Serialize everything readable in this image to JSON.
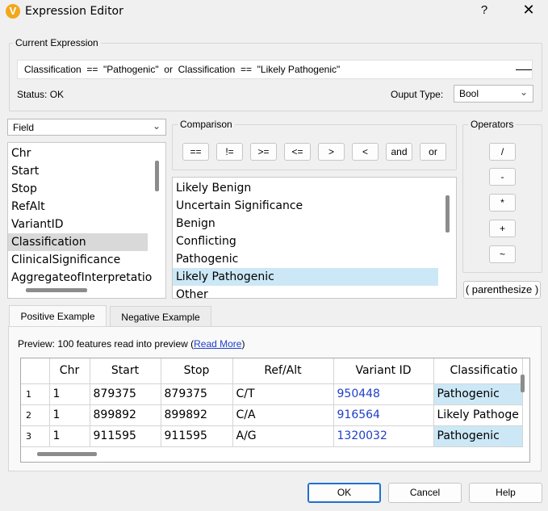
{
  "window": {
    "title": "Expression Editor",
    "app_icon": "V",
    "help": "?",
    "close": "✕"
  },
  "current_expression": {
    "label": "Current Expression",
    "value": "Classification  ==  \"Pathogenic\"  or  Classification  ==  \"Likely Pathogenic\"",
    "status": "Status: OK",
    "output_type_label": "Ouput Type:",
    "output_type_value": "Bool"
  },
  "field": {
    "select_value": "Field",
    "items": [
      "Chr",
      "Start",
      "Stop",
      "RefAlt",
      "VariantID",
      "Classification",
      "ClinicalSignificance",
      "AggregateofInterpretatio"
    ],
    "selected_index": 5
  },
  "comparison": {
    "label": "Comparison",
    "buttons": [
      "==",
      "!=",
      ">=",
      "<=",
      ">",
      "<",
      "and",
      "or"
    ],
    "values": [
      "Likely Benign",
      "Uncertain Significance",
      "Benign",
      "Conflicting",
      "Pathogenic",
      "Likely Pathogenic",
      "Other"
    ],
    "selected_index": 5
  },
  "operators": {
    "label": "Operators",
    "buttons": [
      "/",
      "-",
      "*",
      "+",
      "~"
    ],
    "parenthesize": "( parenthesize )"
  },
  "tabs": {
    "positive": "Positive Example",
    "negative": "Negative Example"
  },
  "preview": {
    "text": "Preview: 100 features read into preview (",
    "link": "Read More",
    "close": ")",
    "columns": [
      "",
      "Chr",
      "Start",
      "Stop",
      "Ref/Alt",
      "Variant ID",
      "Classificatio"
    ],
    "rows": [
      {
        "n": "1",
        "chr": "1",
        "start": "879375",
        "stop": "879375",
        "refalt": "C/T",
        "vid": "950448",
        "cls": "Pathogenic"
      },
      {
        "n": "2",
        "chr": "1",
        "start": "899892",
        "stop": "899892",
        "refalt": "C/A",
        "vid": "916564",
        "cls": "Likely Pathoge"
      },
      {
        "n": "3",
        "chr": "1",
        "start": "911595",
        "stop": "911595",
        "refalt": "A/G",
        "vid": "1320032",
        "cls": "Pathogenic"
      }
    ]
  },
  "footer": {
    "ok": "OK",
    "cancel": "Cancel",
    "help": "Help"
  },
  "colors": {
    "accent": "#1f6fd0",
    "selection": "#cce8f6",
    "link": "#1f3fc7",
    "app_icon": "#f1a81c"
  }
}
